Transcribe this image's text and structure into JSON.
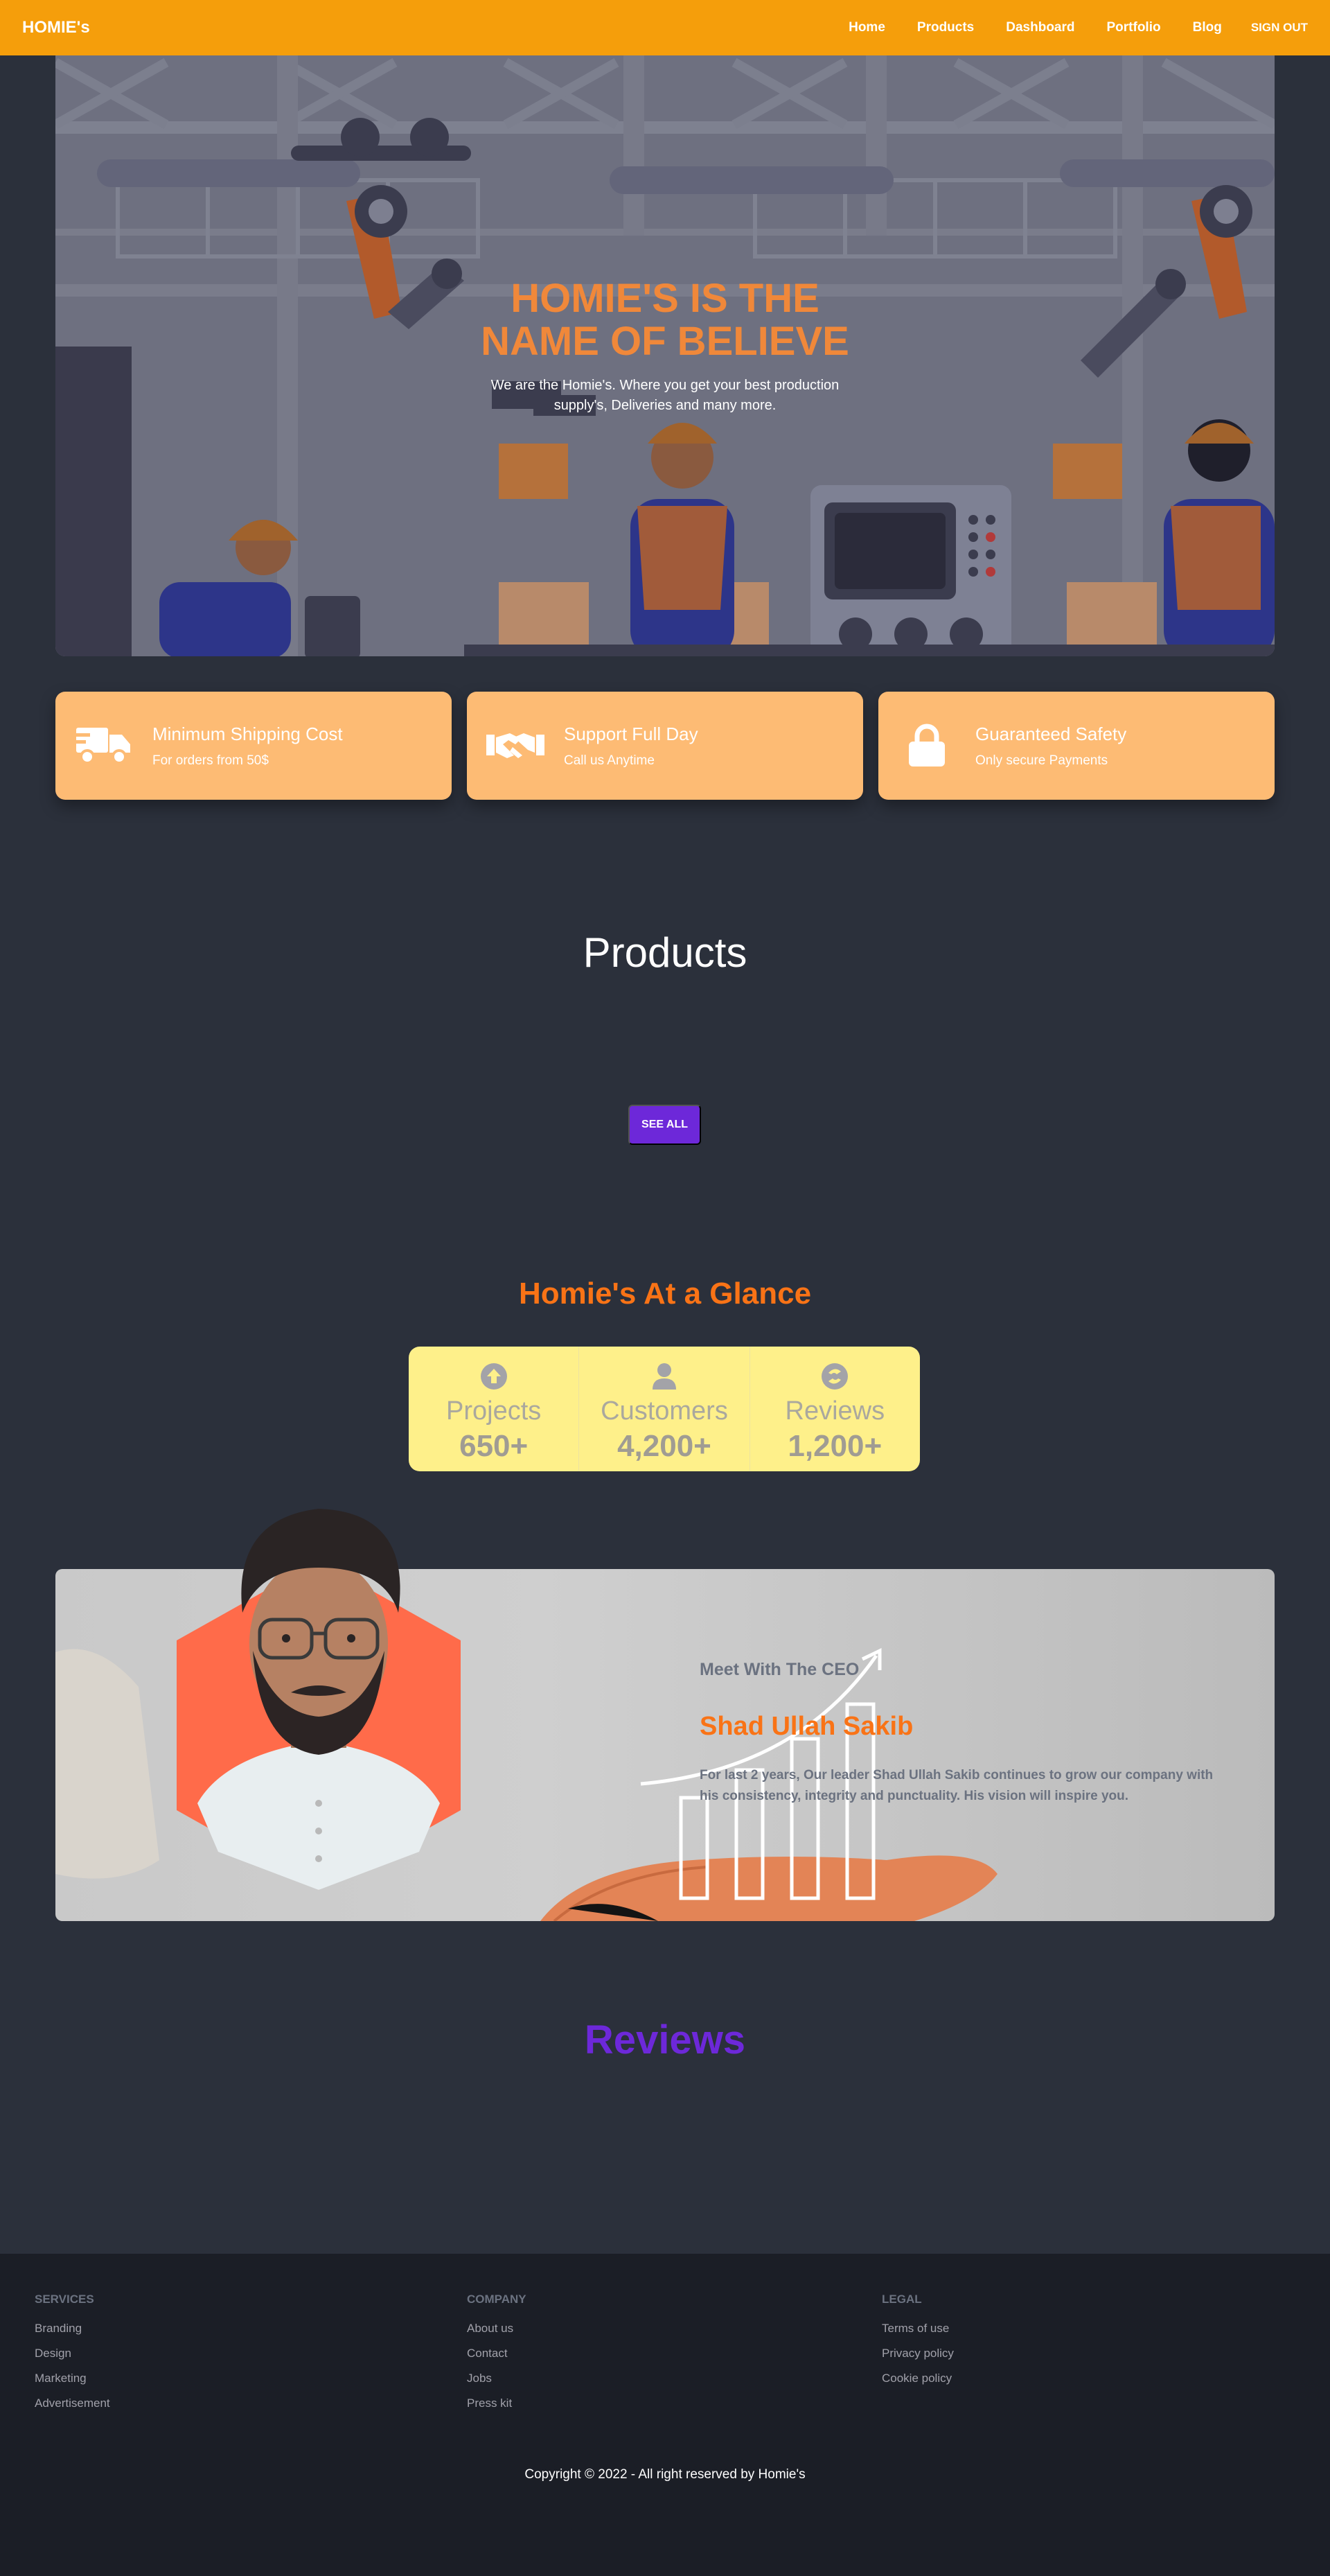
{
  "nav": {
    "brand": "HOMIE's",
    "links": [
      "Home",
      "Products",
      "Dashboard",
      "Portfolio",
      "Blog"
    ],
    "signout": "SIGN OUT",
    "bg_color": "#f59e0b"
  },
  "hero": {
    "title": "HOMIE'S IS THE NAME OF BELIEVE",
    "subtitle": "We are the Homie's. Where you get your best production supply's, Deliveries and many more."
  },
  "features": [
    {
      "icon": "truck-icon",
      "title": "Minimum Shipping Cost",
      "desc": "For orders from 50$"
    },
    {
      "icon": "handshake-icon",
      "title": "Support Full Day",
      "desc": "Call us Anytime"
    },
    {
      "icon": "lock-icon",
      "title": "Guaranteed Safety",
      "desc": "Only secure Payments"
    }
  ],
  "products": {
    "title": "Products",
    "see_all": "SEE ALL"
  },
  "glance": {
    "title": "Homie's At a Glance",
    "stats": [
      {
        "icon": "arrow-up-circle-icon",
        "label": "Projects",
        "value": "650+"
      },
      {
        "icon": "user-icon",
        "label": "Customers",
        "value": "4,200+"
      },
      {
        "icon": "review-icon",
        "label": "Reviews",
        "value": "1,200+"
      }
    ]
  },
  "ceo": {
    "meet": "Meet With The CEO",
    "name": "Shad Ullah Sakib",
    "bio": "For last 2 years, Our leader Shad Ullah Sakib continues to grow our company with his consistency, integrity and punctuality. His vision will inspire you."
  },
  "reviews": {
    "title": "Reviews"
  },
  "footer": {
    "columns": [
      {
        "title": "SERVICES",
        "links": [
          "Branding",
          "Design",
          "Marketing",
          "Advertisement"
        ]
      },
      {
        "title": "COMPANY",
        "links": [
          "About us",
          "Contact",
          "Jobs",
          "Press kit"
        ]
      },
      {
        "title": "LEGAL",
        "links": [
          "Terms of use",
          "Privacy policy",
          "Cookie policy"
        ]
      }
    ],
    "copyright": "Copyright © 2022 - All right reserved by Homie's"
  }
}
